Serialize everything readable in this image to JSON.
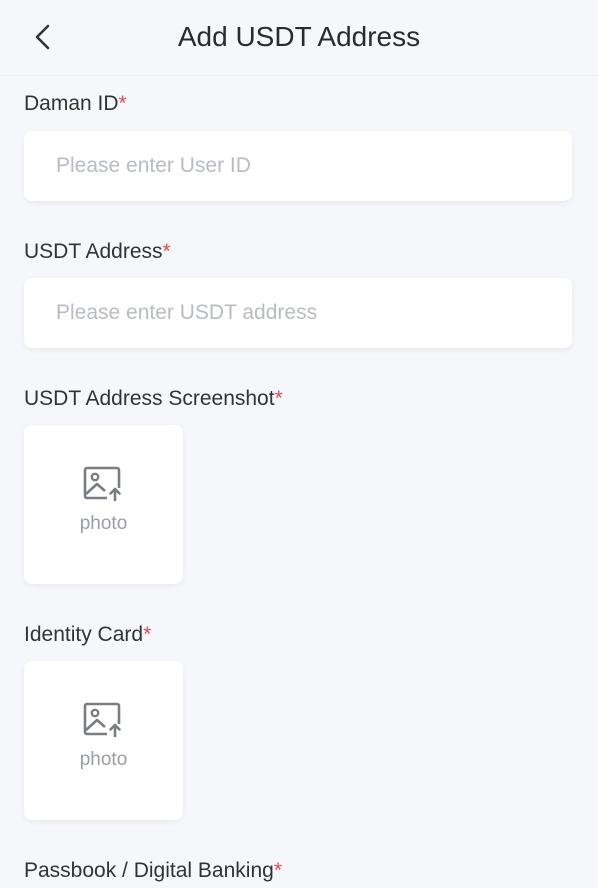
{
  "header": {
    "title": "Add USDT Address",
    "back_icon": "chevron-left-icon"
  },
  "form": {
    "daman_id": {
      "label": "Daman ID",
      "required_mark": "*",
      "placeholder": "Please enter User ID",
      "value": ""
    },
    "usdt_address": {
      "label": "USDT Address",
      "required_mark": "*",
      "placeholder": "Please enter USDT address",
      "value": ""
    },
    "usdt_screenshot": {
      "label": "USDT Address Screenshot",
      "required_mark": "*",
      "upload_text": "photo",
      "icon": "image-upload-icon"
    },
    "identity_card": {
      "label": "Identity Card",
      "required_mark": "*",
      "upload_text": "photo",
      "icon": "image-upload-icon"
    },
    "passbook": {
      "label": "Passbook / Digital Banking",
      "required_mark": "*"
    }
  },
  "colors": {
    "background": "#f6f7fb",
    "required": "#e54b4b",
    "placeholder": "#b9bcc4",
    "icon": "#7a7d85"
  }
}
